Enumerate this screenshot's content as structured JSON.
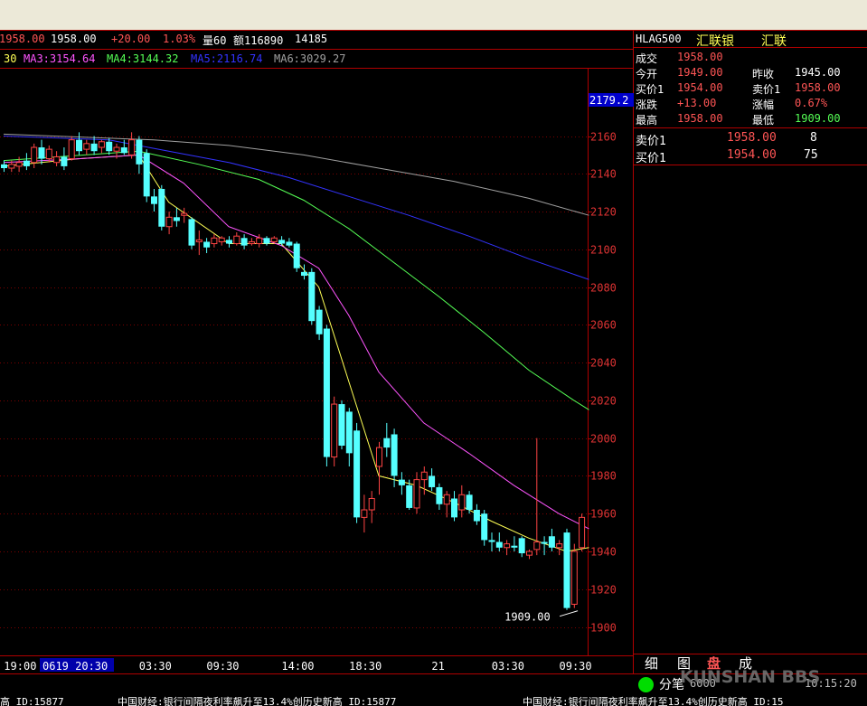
{
  "header": {
    "price_frag": "1958.00",
    "price": "1958.00",
    "change": "+20.00",
    "change_pct": "1.03%",
    "vol_label": "量60",
    "amount_label": "额116890",
    "amount2": "14185"
  },
  "ma_row": [
    {
      "text": "30",
      "color": "#FFFF55"
    },
    {
      "text": "MA3:3154.64",
      "color": "#FF55FF"
    },
    {
      "text": "MA4:3144.32",
      "color": "#55FF55"
    },
    {
      "text": "MA5:2116.74",
      "color": "#3333FF"
    },
    {
      "text": "MA6:3029.27",
      "color": "#A0A0A0"
    }
  ],
  "quote": {
    "symbol": "HLAG500",
    "name1": "汇联银",
    "name2": "汇联",
    "rows": [
      {
        "l1": "成交",
        "v1": "1958.00",
        "c1": "#FF5555",
        "l2": "",
        "v2": "",
        "c2": "#FFFFFF"
      },
      {
        "l1": "今开",
        "v1": "1949.00",
        "c1": "#FF5555",
        "l2": "昨收",
        "v2": "1945.00",
        "c2": "#FFFFFF"
      },
      {
        "l1": "买价1",
        "v1": "1954.00",
        "c1": "#FF5555",
        "l2": "卖价1",
        "v2": "1958.00",
        "c2": "#FF5555"
      },
      {
        "l1": "涨跌",
        "v1": "+13.00",
        "c1": "#FF5555",
        "l2": "涨幅",
        "v2": "0.67%",
        "c2": "#FF5555"
      },
      {
        "l1": "最高",
        "v1": "1958.00",
        "c1": "#FF5555",
        "l2": "最低",
        "v2": "1909.00",
        "c2": "#55FF55"
      }
    ],
    "sell": {
      "label": "卖价1",
      "price": "1958.00",
      "qty": "8"
    },
    "buy": {
      "label": "买价1",
      "price": "1954.00",
      "qty": "75"
    },
    "tabs": [
      "细",
      "图",
      "盘",
      "成"
    ]
  },
  "status": {
    "text": "分笔",
    "extra": "6000",
    "time": "10:15:20",
    "watermark": "KUNSHAN BBS"
  },
  "ticker": [
    "高 ID:15877",
    "中国财经:银行间隔夜利率飙升至13.4%创历史新高 ID:15877",
    "中国财经:银行间隔夜利率飙升至13.4%创历史新高 ID:15"
  ],
  "chart_data": {
    "type": "candlestick",
    "ylim": [
      1885,
      2195
    ],
    "yticks": [
      1900,
      1920,
      1940,
      1960,
      1980,
      2000,
      2020,
      2040,
      2060,
      2080,
      2100,
      2120,
      2140,
      2160
    ],
    "current_price_label": "2179.2",
    "current_price_value": 2179.2,
    "low_annotation": {
      "text": "1909.00",
      "value": 1909.0,
      "index": 77
    },
    "xticks": [
      {
        "label": "19:00",
        "index": 1,
        "highlight": false
      },
      {
        "label": "0619 20:30",
        "index": 7,
        "highlight": true
      },
      {
        "label": "03:30",
        "index": 19,
        "highlight": false
      },
      {
        "label": "09:30",
        "index": 28,
        "highlight": false
      },
      {
        "label": "14:00",
        "index": 38,
        "highlight": false
      },
      {
        "label": "18:30",
        "index": 47,
        "highlight": false
      },
      {
        "label": "21",
        "index": 58,
        "highlight": false
      },
      {
        "label": "03:30",
        "index": 66,
        "highlight": false
      },
      {
        "label": "09:30",
        "index": 75,
        "highlight": false
      }
    ],
    "candles": [
      {
        "o": 2145,
        "h": 2147,
        "l": 2141,
        "c": 2143
      },
      {
        "o": 2143,
        "h": 2147,
        "l": 2141,
        "c": 2145
      },
      {
        "o": 2144,
        "h": 2149,
        "l": 2141,
        "c": 2146
      },
      {
        "o": 2147,
        "h": 2151,
        "l": 2142,
        "c": 2144
      },
      {
        "o": 2146,
        "h": 2156,
        "l": 2143,
        "c": 2154
      },
      {
        "o": 2154,
        "h": 2158,
        "l": 2145,
        "c": 2148
      },
      {
        "o": 2148,
        "h": 2155,
        "l": 2146,
        "c": 2153
      },
      {
        "o": 2146,
        "h": 2152,
        "l": 2144,
        "c": 2149
      },
      {
        "o": 2149,
        "h": 2154,
        "l": 2142,
        "c": 2144
      },
      {
        "o": 2148,
        "h": 2160,
        "l": 2147,
        "c": 2158
      },
      {
        "o": 2158,
        "h": 2162,
        "l": 2150,
        "c": 2152
      },
      {
        "o": 2153,
        "h": 2158,
        "l": 2150,
        "c": 2156
      },
      {
        "o": 2156,
        "h": 2160,
        "l": 2150,
        "c": 2152
      },
      {
        "o": 2154,
        "h": 2158,
        "l": 2151,
        "c": 2157
      },
      {
        "o": 2157,
        "h": 2159,
        "l": 2150,
        "c": 2152
      },
      {
        "o": 2152,
        "h": 2156,
        "l": 2148,
        "c": 2154
      },
      {
        "o": 2154,
        "h": 2158,
        "l": 2150,
        "c": 2151
      },
      {
        "o": 2150,
        "h": 2162,
        "l": 2148,
        "c": 2158
      },
      {
        "o": 2158,
        "h": 2160,
        "l": 2140,
        "c": 2145
      },
      {
        "o": 2151,
        "h": 2153,
        "l": 2125,
        "c": 2128
      },
      {
        "o": 2128,
        "h": 2132,
        "l": 2120,
        "c": 2124
      },
      {
        "o": 2132,
        "h": 2134,
        "l": 2110,
        "c": 2112
      },
      {
        "o": 2112,
        "h": 2120,
        "l": 2108,
        "c": 2117
      },
      {
        "o": 2117,
        "h": 2122,
        "l": 2112,
        "c": 2115
      },
      {
        "o": 2118,
        "h": 2122,
        "l": 2114,
        "c": 2119
      },
      {
        "o": 2116,
        "h": 2117,
        "l": 2100,
        "c": 2102
      },
      {
        "o": 2104,
        "h": 2110,
        "l": 2097,
        "c": 2105
      },
      {
        "o": 2104,
        "h": 2106,
        "l": 2098,
        "c": 2101
      },
      {
        "o": 2103,
        "h": 2108,
        "l": 2101,
        "c": 2106
      },
      {
        "o": 2104,
        "h": 2107,
        "l": 2102,
        "c": 2106
      },
      {
        "o": 2105,
        "h": 2107,
        "l": 2101,
        "c": 2103
      },
      {
        "o": 2103,
        "h": 2109,
        "l": 2102,
        "c": 2107
      },
      {
        "o": 2106,
        "h": 2108,
        "l": 2100,
        "c": 2102
      },
      {
        "o": 2103,
        "h": 2106,
        "l": 2102,
        "c": 2104
      },
      {
        "o": 2103,
        "h": 2108,
        "l": 2101,
        "c": 2106
      },
      {
        "o": 2106,
        "h": 2107,
        "l": 2102,
        "c": 2103
      },
      {
        "o": 2104,
        "h": 2107,
        "l": 2103,
        "c": 2106
      },
      {
        "o": 2105,
        "h": 2107,
        "l": 2102,
        "c": 2103
      },
      {
        "o": 2104,
        "h": 2106,
        "l": 2101,
        "c": 2102
      },
      {
        "o": 2103,
        "h": 2104,
        "l": 2088,
        "c": 2090
      },
      {
        "o": 2088,
        "h": 2092,
        "l": 2084,
        "c": 2086
      },
      {
        "o": 2088,
        "h": 2090,
        "l": 2060,
        "c": 2062
      },
      {
        "o": 2068,
        "h": 2070,
        "l": 2052,
        "c": 2055
      },
      {
        "o": 2058,
        "h": 2060,
        "l": 1985,
        "c": 1990
      },
      {
        "o": 1990,
        "h": 2022,
        "l": 1985,
        "c": 2018
      },
      {
        "o": 2018,
        "h": 2020,
        "l": 1994,
        "c": 1996
      },
      {
        "o": 2014,
        "h": 2016,
        "l": 1985,
        "c": 1992
      },
      {
        "o": 2004,
        "h": 2008,
        "l": 1955,
        "c": 1958
      },
      {
        "o": 1958,
        "h": 1970,
        "l": 1950,
        "c": 1962
      },
      {
        "o": 1962,
        "h": 1972,
        "l": 1955,
        "c": 1968
      },
      {
        "o": 1985,
        "h": 1998,
        "l": 1970,
        "c": 1995
      },
      {
        "o": 2000,
        "h": 2008,
        "l": 1990,
        "c": 1995
      },
      {
        "o": 2002,
        "h": 2005,
        "l": 1974,
        "c": 1980
      },
      {
        "o": 1978,
        "h": 1982,
        "l": 1970,
        "c": 1975
      },
      {
        "o": 1975,
        "h": 1978,
        "l": 1962,
        "c": 1963
      },
      {
        "o": 1963,
        "h": 1982,
        "l": 1960,
        "c": 1978
      },
      {
        "o": 1978,
        "h": 1985,
        "l": 1970,
        "c": 1982
      },
      {
        "o": 1980,
        "h": 1984,
        "l": 1972,
        "c": 1974
      },
      {
        "o": 1974,
        "h": 1976,
        "l": 1962,
        "c": 1965
      },
      {
        "o": 1965,
        "h": 1972,
        "l": 1958,
        "c": 1970
      },
      {
        "o": 1968,
        "h": 1972,
        "l": 1956,
        "c": 1958
      },
      {
        "o": 1962,
        "h": 1975,
        "l": 1958,
        "c": 1970
      },
      {
        "o": 1970,
        "h": 1972,
        "l": 1960,
        "c": 1962
      },
      {
        "o": 1962,
        "h": 1965,
        "l": 1954,
        "c": 1956
      },
      {
        "o": 1960,
        "h": 1962,
        "l": 1943,
        "c": 1946
      },
      {
        "o": 1946,
        "h": 1950,
        "l": 1940,
        "c": 1945
      },
      {
        "o": 1945,
        "h": 1950,
        "l": 1940,
        "c": 1942
      },
      {
        "o": 1942,
        "h": 1946,
        "l": 1938,
        "c": 1944
      },
      {
        "o": 1943,
        "h": 1948,
        "l": 1940,
        "c": 1942
      },
      {
        "o": 1947,
        "h": 1948,
        "l": 1937,
        "c": 1939
      },
      {
        "o": 1938,
        "h": 1941,
        "l": 1936,
        "c": 1940
      },
      {
        "o": 1941,
        "h": 2000,
        "l": 1938,
        "c": 1945
      },
      {
        "o": 1945,
        "h": 1948,
        "l": 1938,
        "c": 1944
      },
      {
        "o": 1948,
        "h": 1952,
        "l": 1940,
        "c": 1942
      },
      {
        "o": 1942,
        "h": 1946,
        "l": 1938,
        "c": 1944
      },
      {
        "o": 1950,
        "h": 1952,
        "l": 1909,
        "c": 1910
      },
      {
        "o": 1912,
        "h": 1944,
        "l": 1910,
        "c": 1940
      },
      {
        "o": 1942,
        "h": 1960,
        "l": 1940,
        "c": 1958
      }
    ],
    "ma_lines": [
      {
        "name": "yellow",
        "color": "#FFFF55",
        "values": [
          [
            0,
            2144
          ],
          [
            10,
            2148
          ],
          [
            18,
            2150
          ],
          [
            22,
            2125
          ],
          [
            30,
            2103
          ],
          [
            37,
            2103
          ],
          [
            42,
            2080
          ],
          [
            46,
            2030
          ],
          [
            50,
            1980
          ],
          [
            55,
            1975
          ],
          [
            60,
            1966
          ],
          [
            65,
            1956
          ],
          [
            70,
            1947
          ],
          [
            75,
            1940
          ],
          [
            78,
            1942
          ]
        ]
      },
      {
        "name": "magenta",
        "color": "#FF55FF",
        "values": [
          [
            0,
            2146
          ],
          [
            10,
            2148
          ],
          [
            18,
            2150
          ],
          [
            24,
            2135
          ],
          [
            30,
            2112
          ],
          [
            37,
            2102
          ],
          [
            42,
            2090
          ],
          [
            46,
            2065
          ],
          [
            50,
            2035
          ],
          [
            56,
            2008
          ],
          [
            62,
            1992
          ],
          [
            68,
            1975
          ],
          [
            74,
            1960
          ],
          [
            78,
            1952
          ]
        ]
      },
      {
        "name": "green",
        "color": "#55FF55",
        "values": [
          [
            0,
            2147
          ],
          [
            18,
            2152
          ],
          [
            26,
            2145
          ],
          [
            34,
            2137
          ],
          [
            40,
            2126
          ],
          [
            46,
            2111
          ],
          [
            52,
            2093
          ],
          [
            58,
            2075
          ],
          [
            64,
            2056
          ],
          [
            70,
            2036
          ],
          [
            76,
            2020
          ],
          [
            78,
            2015
          ]
        ]
      },
      {
        "name": "blue",
        "color": "#3333FF",
        "values": [
          [
            0,
            2160
          ],
          [
            14,
            2158
          ],
          [
            22,
            2152
          ],
          [
            30,
            2146
          ],
          [
            38,
            2138
          ],
          [
            46,
            2128
          ],
          [
            54,
            2118
          ],
          [
            62,
            2107
          ],
          [
            70,
            2095
          ],
          [
            78,
            2084
          ]
        ]
      },
      {
        "name": "gray",
        "color": "#A0A0A0",
        "values": [
          [
            0,
            2161
          ],
          [
            20,
            2158
          ],
          [
            30,
            2155
          ],
          [
            40,
            2150
          ],
          [
            50,
            2143
          ],
          [
            60,
            2136
          ],
          [
            70,
            2127
          ],
          [
            78,
            2118
          ]
        ]
      }
    ]
  }
}
